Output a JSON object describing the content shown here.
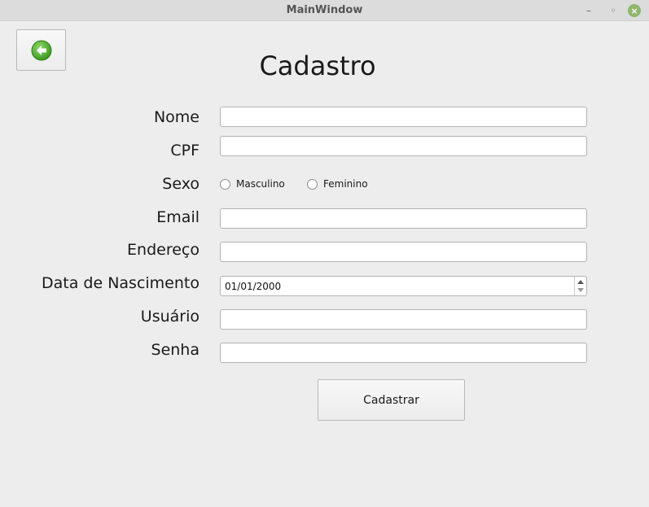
{
  "window": {
    "title": "MainWindow",
    "minimize_glyph": "–",
    "maximize_glyph": "◦",
    "close_glyph": "×"
  },
  "icons": {
    "back": "back-arrow-icon"
  },
  "colors": {
    "back_icon_fill": "#4cae2c",
    "close_button": "#8fb66a"
  },
  "page": {
    "title": "Cadastro"
  },
  "form": {
    "nome_label": "Nome",
    "cpf_label": "CPF",
    "sexo_label": "Sexo",
    "sexo_options": [
      "Masculino",
      "Feminino"
    ],
    "email_label": "Email",
    "endereco_label": "Endereço",
    "nascimento_label": "Data de Nascimento",
    "nascimento_value": "01/01/2000",
    "usuario_label": "Usuário",
    "senha_label": "Senha",
    "nome_value": "",
    "cpf_value": "",
    "email_value": "",
    "endereco_value": "",
    "usuario_value": "",
    "senha_value": "",
    "submit_label": "Cadastrar"
  }
}
